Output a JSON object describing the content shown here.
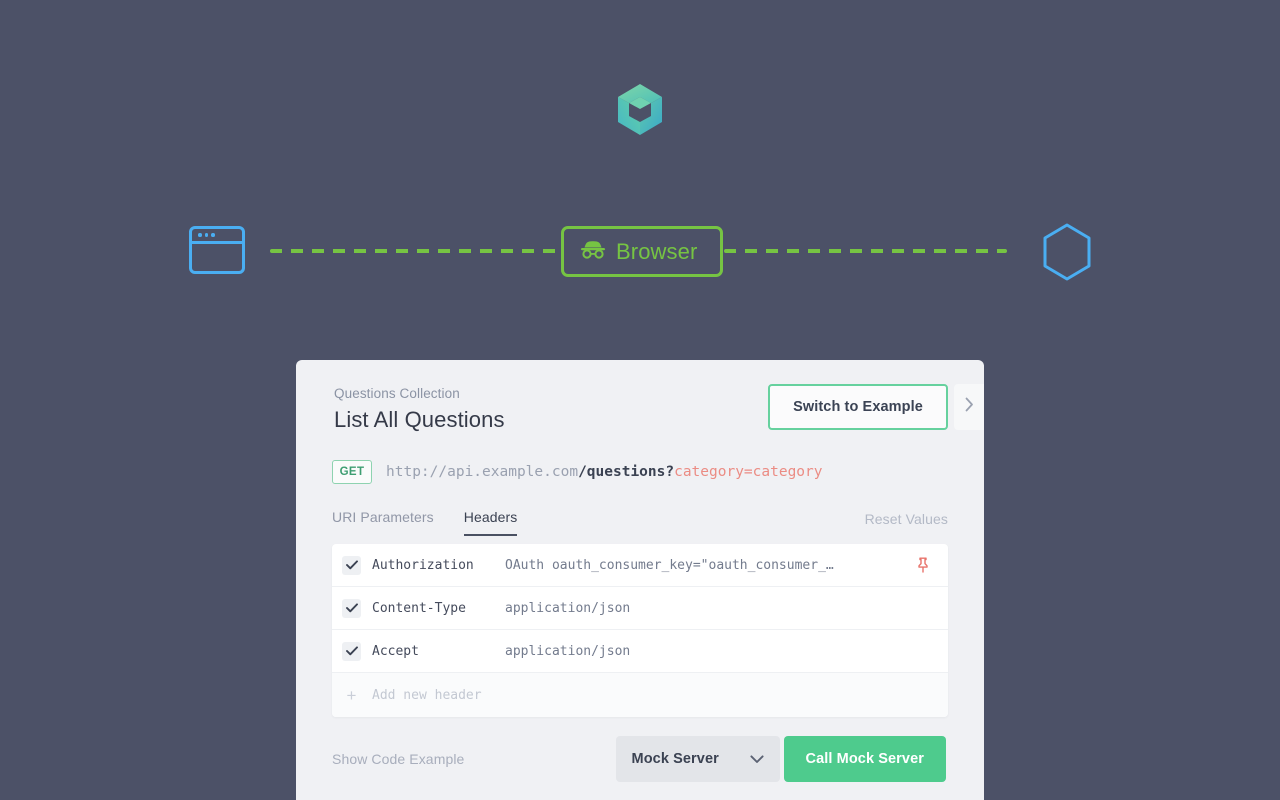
{
  "theme": {
    "background": "#4c5167",
    "card_background": "#f0f1f4",
    "accent_green": "#4ecb8d",
    "dash_green": "#76c443",
    "icon_blue": "#4aaef2",
    "query_red": "#eb8c84",
    "pin_red": "#e8736b"
  },
  "diagram": {
    "browser_window_icon": "browser-window-icon",
    "badge_label": "Browser",
    "badge_icon": "incognito-icon",
    "hexagon_icon": "hexagon-icon",
    "logo_icon": "app-logo-icon"
  },
  "card": {
    "collection_name": "Questions Collection",
    "title": "List All Questions",
    "switch_button": "Switch to Example",
    "next_icon": "chevron-right-icon",
    "request": {
      "method": "GET",
      "url_base": "http://api.example.com",
      "url_path": "/questions?",
      "url_query": "category=category"
    },
    "tabs": [
      {
        "label": "URI Parameters",
        "active": false
      },
      {
        "label": "Headers",
        "active": true
      }
    ],
    "reset_values": "Reset Values",
    "headers": [
      {
        "checked": true,
        "key": "Authorization",
        "value": "OAuth oauth_consumer_key=\"oauth_consumer_…",
        "pinned": true
      },
      {
        "checked": true,
        "key": "Content-Type",
        "value": "application/json",
        "pinned": false
      },
      {
        "checked": true,
        "key": "Accept",
        "value": "application/json",
        "pinned": false
      }
    ],
    "add_header_placeholder": "Add new header",
    "footer": {
      "show_code": "Show Code Example",
      "server_selected": "Mock Server",
      "call_button": "Call Mock Server"
    }
  }
}
